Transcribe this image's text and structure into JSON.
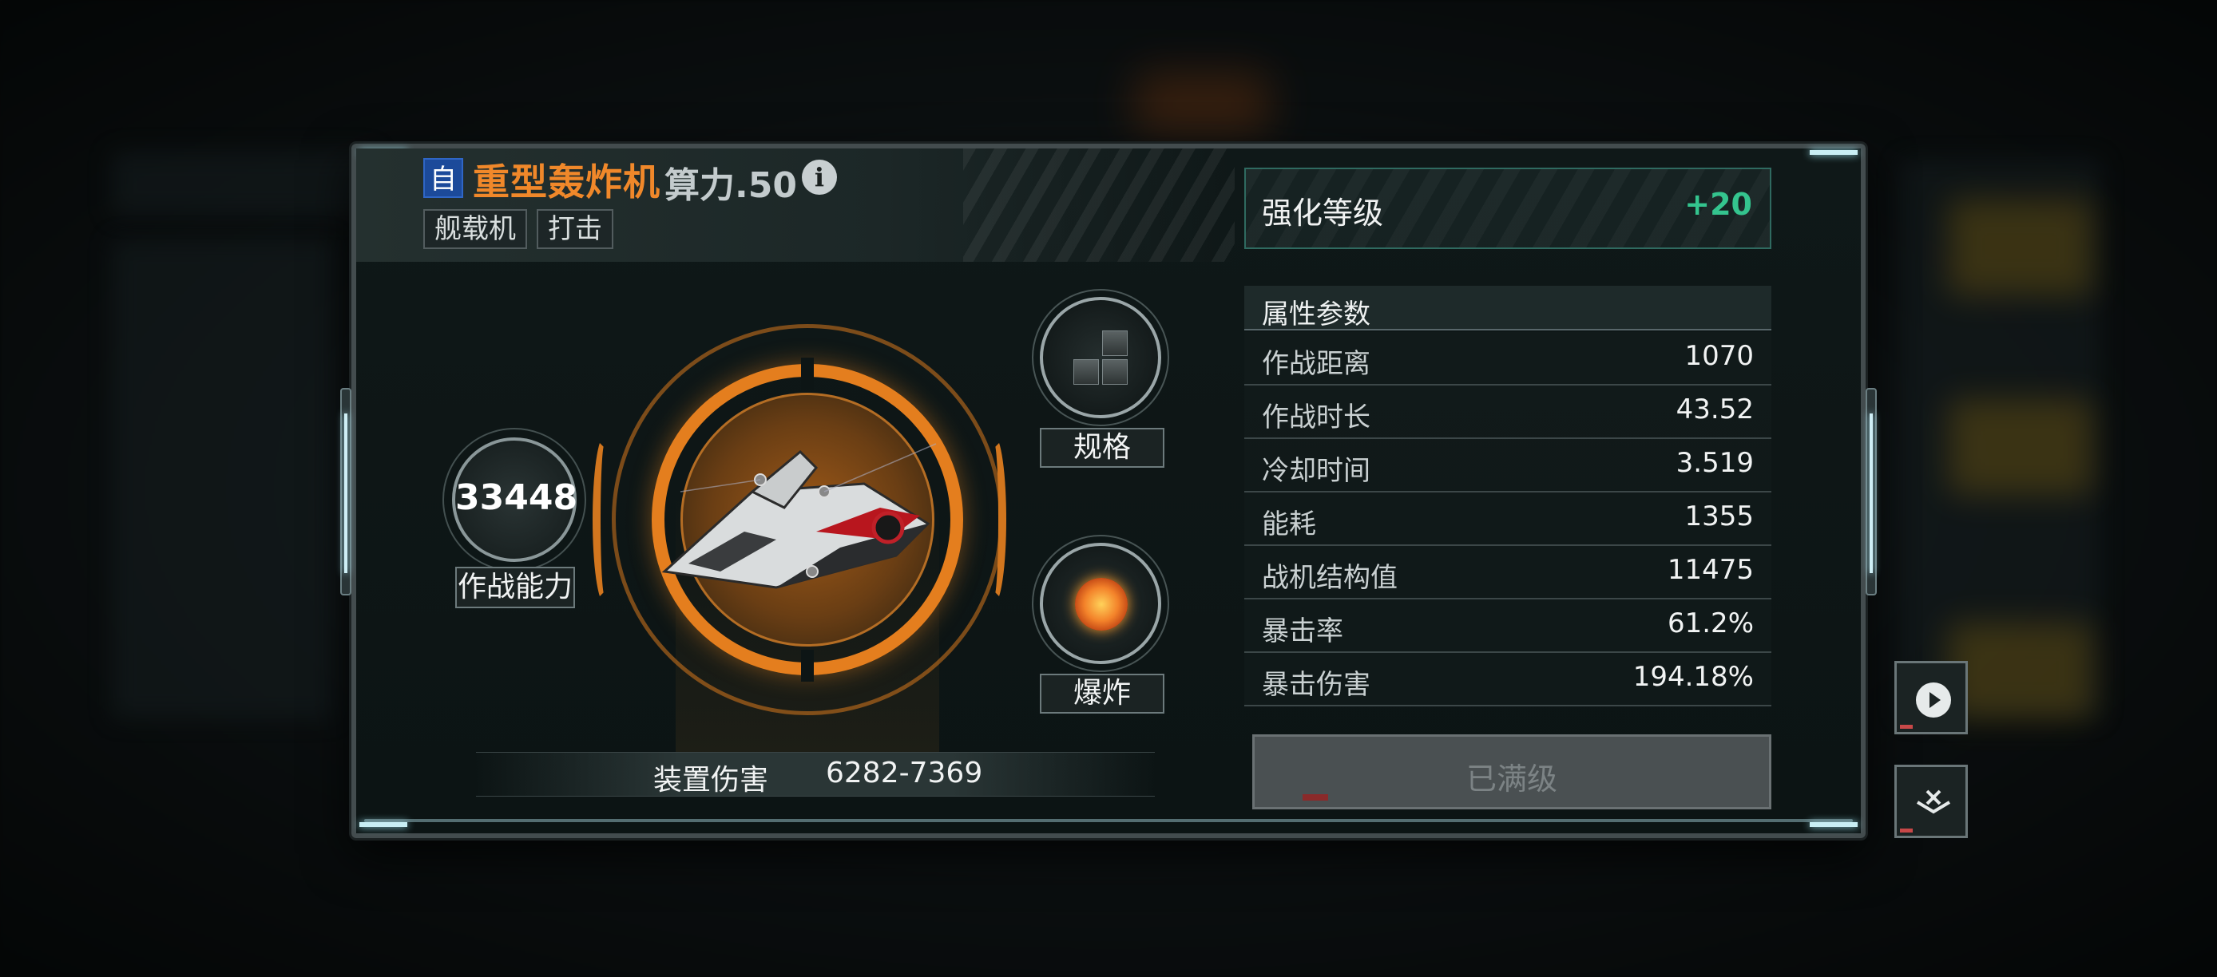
{
  "header": {
    "badge": "自",
    "name": "重型轰炸机",
    "power_label": "算力.50",
    "info_icon": "info-icon",
    "tags": [
      "舰载机",
      "打击"
    ]
  },
  "enhancement": {
    "label": "强化等级",
    "value": "+20"
  },
  "combat": {
    "power_value": "33448",
    "power_label": "作战能力",
    "spec_label": "规格",
    "type_label": "爆炸",
    "damage_label": "装置伤害",
    "damage_value": "6282-7369"
  },
  "attributes": {
    "title": "属性参数",
    "rows": [
      {
        "label": "作战距离",
        "value": "1070"
      },
      {
        "label": "作战时长",
        "value": "43.52"
      },
      {
        "label": "冷却时间",
        "value": "3.519"
      },
      {
        "label": "能耗",
        "value": "1355"
      },
      {
        "label": "战机结构值",
        "value": "11475"
      },
      {
        "label": "暴击率",
        "value": "61.2%"
      },
      {
        "label": "暴击伤害",
        "value": "194.18%"
      }
    ]
  },
  "action": {
    "max_label": "已满级"
  },
  "side_buttons": [
    "play-icon",
    "collapse-icon"
  ],
  "colors": {
    "accent_orange": "#f0882a",
    "enhance_green": "#34c48e",
    "self_badge_blue": "#1c4a9a"
  }
}
